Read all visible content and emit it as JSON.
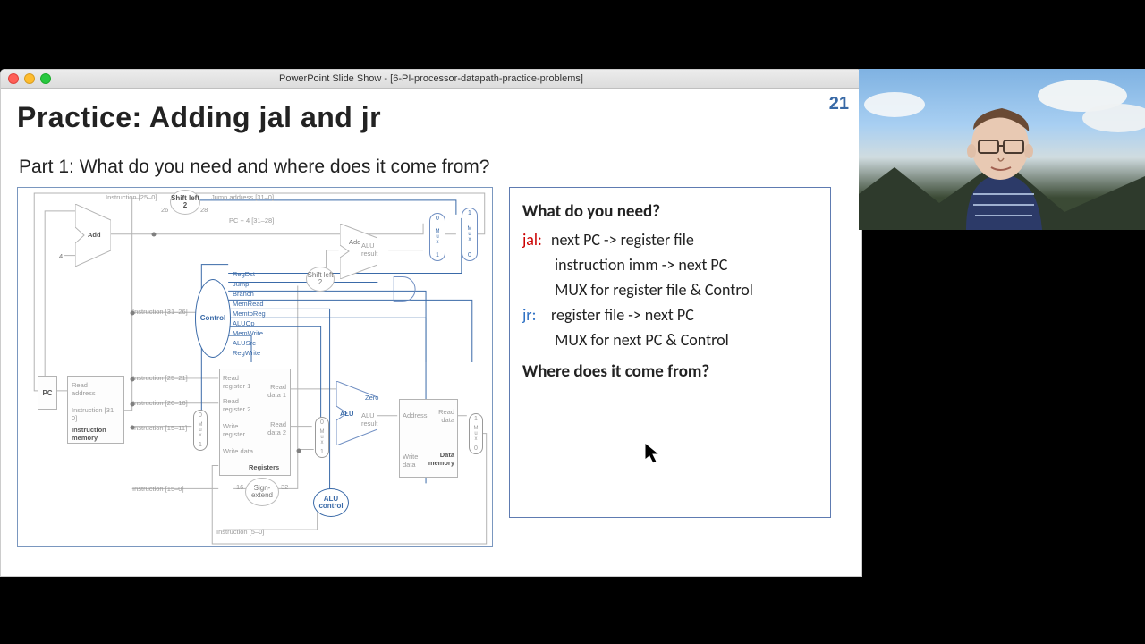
{
  "window": {
    "title": "PowerPoint Slide Show - [6-PI-processor-datapath-practice-problems]"
  },
  "slide": {
    "number": "21",
    "title": "Practice: Adding jal and jr",
    "subtitle": "Part 1: What do you need and where does it come from?"
  },
  "diagram": {
    "instr_top": "Instruction [25–0]",
    "shift_left_2a": "Shift left 2",
    "jump_addr": "Jump address [31–0]",
    "n26": "26",
    "n28": "28",
    "pc4_hi": "PC + 4 [31–28]",
    "add1": "Add",
    "four": "4",
    "instr_opc": "Instruction [31–26]",
    "control": "Control",
    "control_signals": [
      "RegDst",
      "Jump",
      "Branch",
      "MemRead",
      "MemtoReg",
      "ALUOp",
      "MemWrite",
      "ALUSrc",
      "RegWrite"
    ],
    "shift_left_2b": "Shift left 2",
    "add_alu_result": "ALU result",
    "add2": "Add",
    "pc": "PC",
    "read_addr": "Read address",
    "instr_mem_instr": "Instruction [31–0]",
    "instr_mem": "Instruction memory",
    "field_rs": "Instruction [25–21]",
    "field_rt": "Instruction [20–16]",
    "field_rd": "Instruction [15–11]",
    "field_imm": "Instruction [15–0]",
    "field_funct": "Instruction [5–0]",
    "reg_r1": "Read register 1",
    "reg_r2": "Read register 2",
    "reg_w": "Write register",
    "reg_wd": "Write data",
    "reg_rd1": "Read data 1",
    "reg_rd2": "Read data 2",
    "registers": "Registers",
    "sign_extend": "Sign-extend",
    "n16": "16",
    "n32": "32",
    "alu": "ALU",
    "alu_zero": "Zero",
    "alu_result": "ALU result",
    "alu_control": "ALU control",
    "mem_addr": "Address",
    "mem_rd": "Read data",
    "mem_wd": "Write data",
    "data_mem": "Data memory",
    "mux": "M u x",
    "m0": "0",
    "m1": "1"
  },
  "notes": {
    "heading1": "What do you need?",
    "jal_label": "jal:",
    "jal_lines": [
      "next PC -> register file",
      "instruction imm -> next PC",
      "MUX for register file & Control"
    ],
    "jr_label": "jr:",
    "jr_lines": [
      "register file -> next PC",
      "MUX for next PC & Control"
    ],
    "heading2": "Where does it come from?"
  }
}
